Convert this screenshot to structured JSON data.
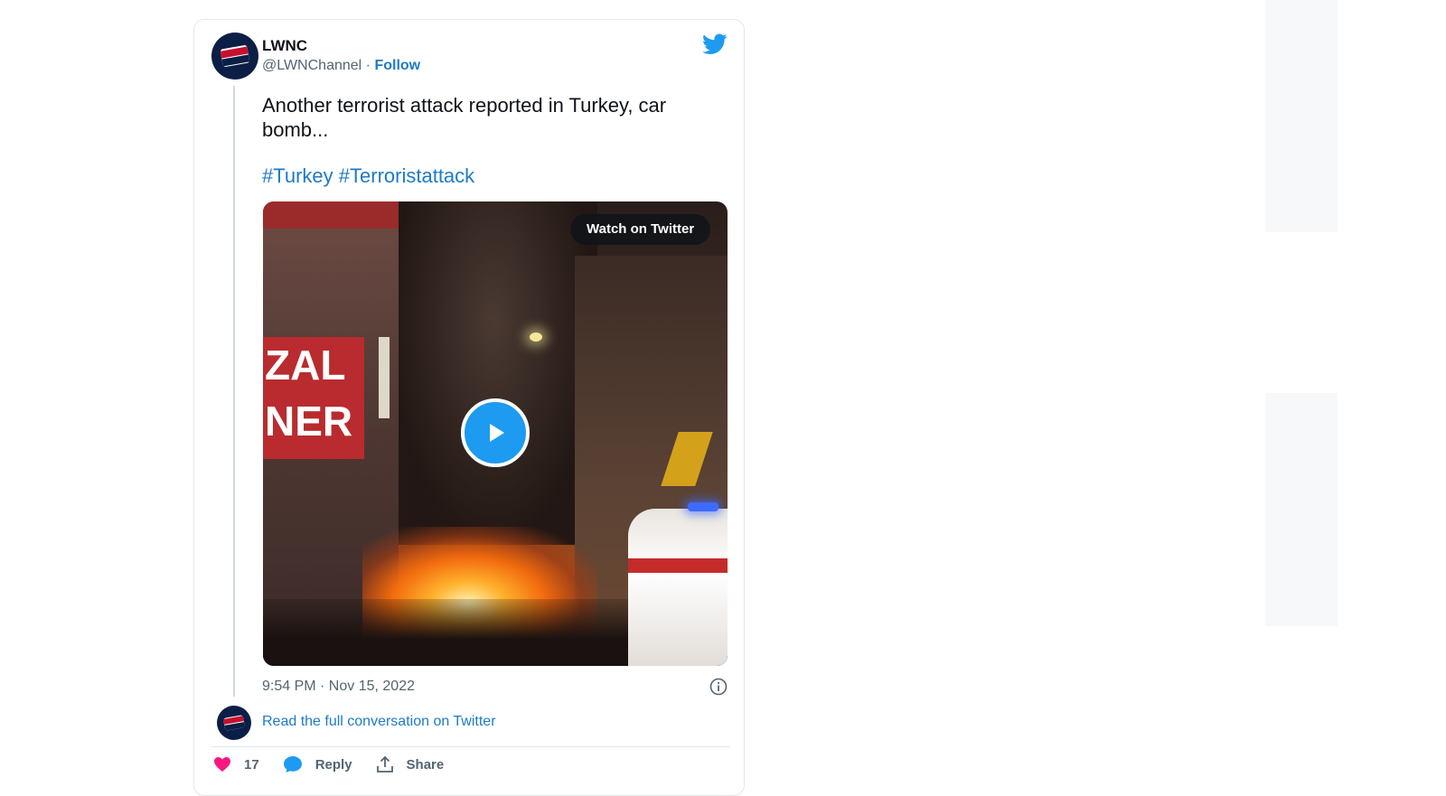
{
  "tweet": {
    "author_name": "LWNC",
    "handle": "@LWNChannel",
    "separator": "·",
    "follow_label": "Follow",
    "text": "Another terrorist attack reported in Turkey, car bomb...",
    "hashtags": [
      "#Turkey",
      "#Terroristattack"
    ],
    "media": {
      "watch_label": "Watch on Twitter",
      "sign_text_line1": "ZAL",
      "sign_text_line2": "NER"
    },
    "timestamp": "9:54 PM · Nov 15, 2022",
    "read_full_label": "Read the full conversation on Twitter",
    "actions": {
      "likes_count": "17",
      "reply_label": "Reply",
      "share_label": "Share"
    }
  },
  "colors": {
    "link": "#1d7ac9",
    "twitter_blue": "#1d9bf0",
    "like_pink": "#f91880",
    "avatar_navy": "#0b1f46"
  },
  "icons": {
    "brand": "twitter-bird-icon",
    "play": "play-icon",
    "info": "info-icon",
    "like": "heart-icon",
    "reply": "reply-bubble-icon",
    "share": "share-upload-icon"
  }
}
